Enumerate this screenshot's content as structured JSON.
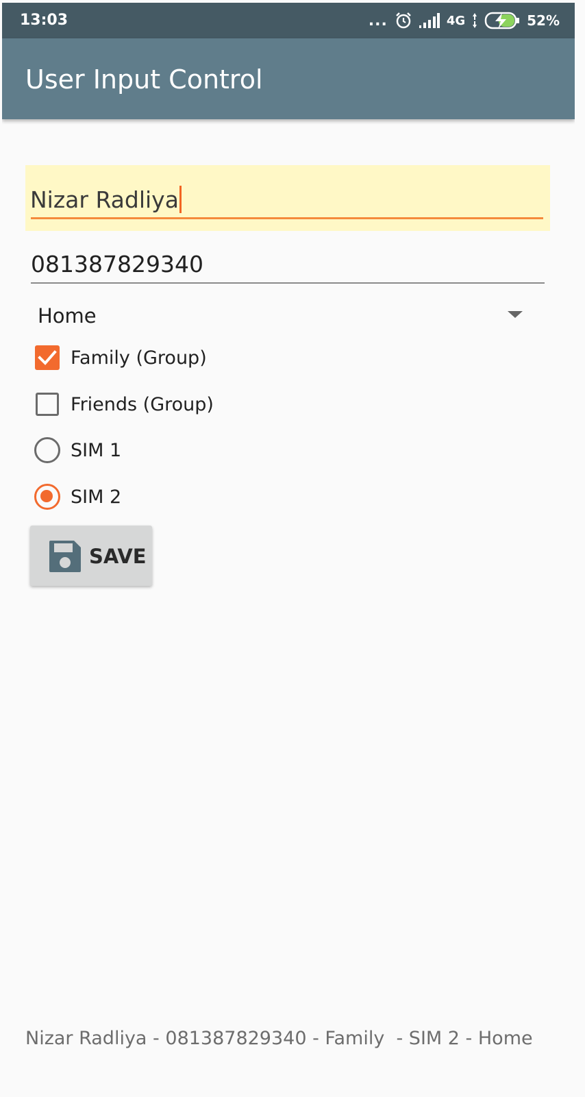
{
  "status_bar": {
    "time": "13:03",
    "dots": "...",
    "network": "4G",
    "battery_percent": "52%",
    "icons": [
      "alarm-icon",
      "signal-icon",
      "data-arrows-icon",
      "battery-charging-icon"
    ]
  },
  "app_bar": {
    "title": "User Input Control"
  },
  "form": {
    "name_value": "Nizar Radliya",
    "phone_value": "081387829340",
    "spinner_selected": "Home",
    "checkboxes": [
      {
        "label": "Family (Group)",
        "checked": true
      },
      {
        "label": "Friends (Group)",
        "checked": false
      }
    ],
    "radios": [
      {
        "label": "SIM 1",
        "selected": false
      },
      {
        "label": "SIM 2",
        "selected": true
      }
    ],
    "save_label": "SAVE"
  },
  "summary_text": "Nizar Radliya - 081387829340 - Family  - SIM 2 - Home",
  "colors": {
    "status_bar": "#455a64",
    "app_bar": "#607d8b",
    "accent": "#f26a2e",
    "focused_field_bg": "#fff8c6"
  }
}
